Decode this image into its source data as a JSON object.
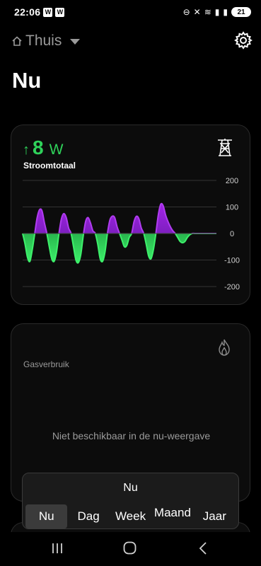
{
  "status_bar": {
    "time": "22:06",
    "badge1": "W",
    "badge2": "W",
    "battery": "21"
  },
  "header": {
    "location": "Thuis",
    "page_title": "Nu"
  },
  "power_card": {
    "arrow": "↑",
    "value": "8",
    "unit": "W",
    "label": "Stroomtotaal",
    "positive_color": "#9b2bd8",
    "negative_color": "#2bd24e"
  },
  "chart_data": {
    "type": "area",
    "yticks": [
      "200",
      "100",
      "0",
      "-100",
      "-200"
    ],
    "ylim": [
      -200,
      200
    ],
    "x": [
      0,
      1,
      2,
      3,
      4,
      5,
      6,
      7,
      8,
      9,
      10,
      11,
      12,
      13,
      14,
      15,
      16,
      17,
      18,
      19,
      20,
      21,
      22,
      23,
      24,
      25,
      26,
      27,
      28,
      29,
      30,
      31,
      32,
      33,
      34,
      35,
      36,
      37,
      38,
      39,
      40,
      41,
      42,
      43,
      44,
      45,
      46,
      47,
      48,
      49,
      50,
      51,
      52,
      53,
      54,
      55,
      56,
      57,
      58,
      59,
      60,
      61,
      62,
      63,
      64,
      65,
      66,
      67,
      68,
      69,
      70,
      71,
      72,
      73,
      74,
      75,
      76,
      77,
      78,
      79,
      80
    ],
    "values": [
      0,
      -40,
      -90,
      -105,
      -60,
      0,
      60,
      90,
      85,
      40,
      0,
      -50,
      -95,
      -105,
      -70,
      0,
      55,
      75,
      60,
      20,
      0,
      -50,
      -100,
      -110,
      -80,
      -10,
      45,
      60,
      40,
      10,
      0,
      -40,
      -95,
      -105,
      -70,
      0,
      50,
      65,
      60,
      25,
      0,
      -25,
      -50,
      -45,
      -15,
      0,
      45,
      65,
      55,
      20,
      0,
      -40,
      -85,
      -95,
      -60,
      0,
      70,
      110,
      105,
      70,
      45,
      25,
      10,
      0,
      -15,
      -30,
      -35,
      -30,
      -15,
      -5,
      0,
      0,
      0,
      0,
      0,
      0,
      0,
      0,
      0,
      0,
      0
    ],
    "grid": true
  },
  "gas_card": {
    "label": "Gasverbruik",
    "message": "Niet beschikbaar in de nu-weergave"
  },
  "period_selector": {
    "title": "Nu",
    "tabs": [
      "Nu",
      "Dag",
      "Week",
      "Maand",
      "Jaar"
    ],
    "active_index": 0
  }
}
